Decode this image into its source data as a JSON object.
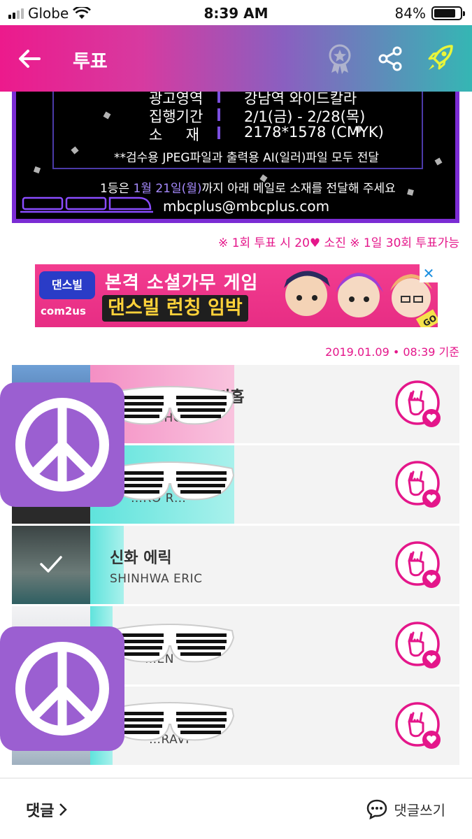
{
  "status_bar": {
    "carrier": "Globe",
    "time": "8:39 AM",
    "battery": "84%",
    "battery_level": 0.84
  },
  "header": {
    "title": "투표"
  },
  "poster": {
    "rows": [
      {
        "key": "광고영역",
        "value": "강남역 와이드칼라"
      },
      {
        "key": "집행기간",
        "value": "2/1(금) - 2/28(목)"
      },
      {
        "key": "소     재",
        "value": "2178*1578 (CMYK)"
      }
    ],
    "note": "**검수용 JPEG파일과 출력용 AI(일러)파일 모두 전달",
    "deadline_prefix": "1등은 ",
    "deadline_date": "1월 21일(월)",
    "deadline_suffix": "까지 아래 메일로 소재를 전달해 주세요",
    "email": "mbcplus@mbcplus.com"
  },
  "vote_rule": "※ 1회 투표 시 20♥ 소진 ※ 1일 30회 투표가능",
  "ad": {
    "logo": "댄스빌",
    "logo_sub": "com2us",
    "line1": "본격 소셜가무 게임",
    "line2": "댄스빌 런칭 임박",
    "badge": "GO",
    "close": "✕"
  },
  "timestamp": "2019.01.09 • 08:39 기준",
  "candidates": [
    {
      "name": "…키홉",
      "name_en": "…HO…",
      "bar_color": "#f7a6cf",
      "bar_share": 0.39,
      "photo_color": "#5c86c4"
    },
    {
      "name": "",
      "name_en": "…RO R…",
      "bar_color": "#5fe3dc",
      "bar_share": 0.39,
      "photo_color": "#3d3d3d"
    },
    {
      "name": "신화 에릭",
      "name_en": "SHINHWA ERIC",
      "bar_color": "#5fe3dc",
      "bar_share": 0.09,
      "photo_color": "#4a5a5a",
      "voted": true
    },
    {
      "name": "",
      "name_en": "…EN",
      "bar_color": "#5fe3dc",
      "bar_share": 0.06,
      "photo_color": "#d9d9dc"
    },
    {
      "name": "",
      "name_en": "…RAVI",
      "bar_color": "#5fe3dc",
      "bar_share": 0.06,
      "photo_color": "#b7c3cc"
    }
  ],
  "footer": {
    "comments_label": "댓글",
    "write_label": "댓글쓰기"
  },
  "icons": {
    "back": "arrow-left-icon",
    "badge": "award-ribbon-icon",
    "share": "share-icon",
    "rocket": "rocket-icon",
    "vote": "rock-hand-heart-icon",
    "peace": "peace-sign-icon",
    "glasses": "shutter-shades-icon",
    "check": "check-icon",
    "comment": "chat-bubble-icon"
  },
  "colors": {
    "accent": "#e4168a",
    "header_start": "#ec1a8c",
    "header_end": "#35b6b4",
    "poster_frame": "#7b2cd4",
    "sticker": "#9b5fd1"
  }
}
